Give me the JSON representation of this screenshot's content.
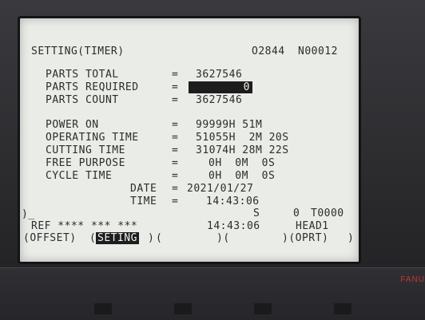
{
  "header": {
    "title": "SETTING(TIMER)",
    "program": "O2844",
    "sequence": "N00012"
  },
  "counters": [
    {
      "label": "PARTS TOTAL",
      "eq": "=",
      "value": "3627546"
    },
    {
      "label": "PARTS REQUIRED",
      "eq": "=",
      "value": "0"
    },
    {
      "label": "PARTS COUNT",
      "eq": "=",
      "value": "3627546"
    }
  ],
  "times": [
    {
      "label": "POWER ON",
      "eq": "=",
      "value": "99999H 51M"
    },
    {
      "label": "OPERATING TIME",
      "eq": "=",
      "value": "51055H  2M 20S"
    },
    {
      "label": "CUTTING TIME",
      "eq": "=",
      "value": "31074H 28M 22S"
    },
    {
      "label": "FREE PURPOSE",
      "eq": "=",
      "value": "0H  0M  0S"
    },
    {
      "label": "CYCLE TIME",
      "eq": "=",
      "value": "0H  0M  0S"
    }
  ],
  "date": {
    "label": "DATE",
    "eq": "=",
    "value": "2021/01/27"
  },
  "time": {
    "label": "TIME",
    "eq": "=",
    "value": "14:43:06"
  },
  "status": {
    "s_label": "S",
    "s_value": "0",
    "tool": "T0000",
    "prompt": ")_",
    "mode": "REF **** *** ***",
    "clock": "14:43:06",
    "head": "HEAD1"
  },
  "softkeys": {
    "offset": "(OFFSET)",
    "seting": "SETING",
    "open1": "(",
    "close1": ")",
    "open2": ")(",
    "oprt": ")(OPRT)",
    "end": ")"
  },
  "brand": "FANU",
  "colors": {
    "screen": "#eaece8",
    "text": "#2c2c2c",
    "highlight": "#1d1d1d",
    "bezel": "#2b2b2e"
  }
}
